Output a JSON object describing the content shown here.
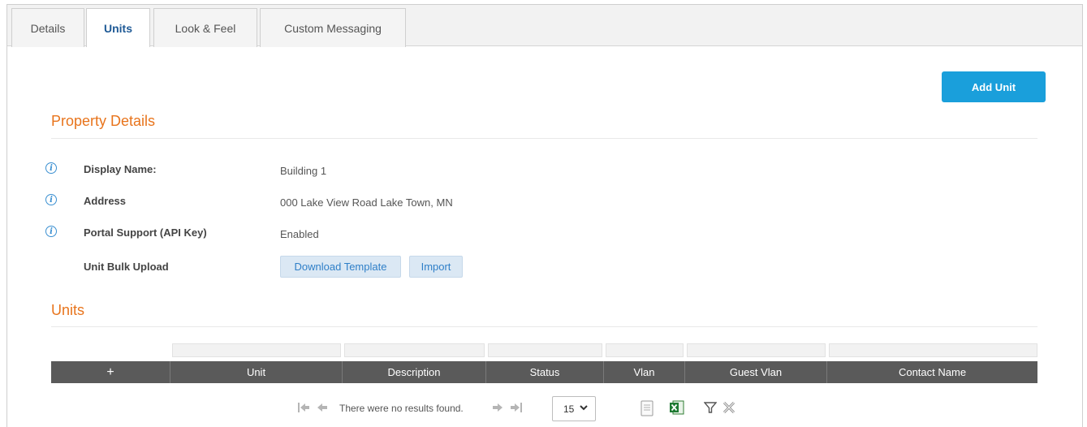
{
  "tabs": [
    {
      "label": "Details",
      "active": false
    },
    {
      "label": "Units",
      "active": true
    },
    {
      "label": "Look & Feel",
      "active": false
    },
    {
      "label": "Custom Messaging",
      "active": false
    }
  ],
  "actions": {
    "add_unit_label": "Add Unit"
  },
  "property_details": {
    "title": "Property Details",
    "rows": [
      {
        "label": "Display Name:",
        "value": "Building 1",
        "icon": "info-icon"
      },
      {
        "label": "Address",
        "value": "000 Lake View Road Lake Town, MN",
        "icon": "info-icon"
      },
      {
        "label": "Portal Support (API Key)",
        "value": "Enabled",
        "icon": "info-icon"
      }
    ],
    "bulk_upload": {
      "label": "Unit Bulk Upload",
      "download_label": "Download Template",
      "import_label": "Import"
    }
  },
  "units": {
    "title": "Units",
    "add_row_symbol": "+",
    "columns": [
      "Unit",
      "Description",
      "Status",
      "Vlan",
      "Guest Vlan",
      "Contact Name"
    ],
    "empty_message": "There were no results found.",
    "page_size": "15"
  },
  "colors": {
    "accent_orange": "#e8741c",
    "primary_blue": "#1a9fdb",
    "header_gray": "#5a5a5a"
  },
  "icons": [
    "info-icon",
    "first-page-icon",
    "prev-page-icon",
    "next-page-icon",
    "last-page-icon",
    "chevron-down-icon",
    "export-document-icon",
    "export-excel-icon",
    "filter-icon",
    "clear-filter-icon"
  ]
}
